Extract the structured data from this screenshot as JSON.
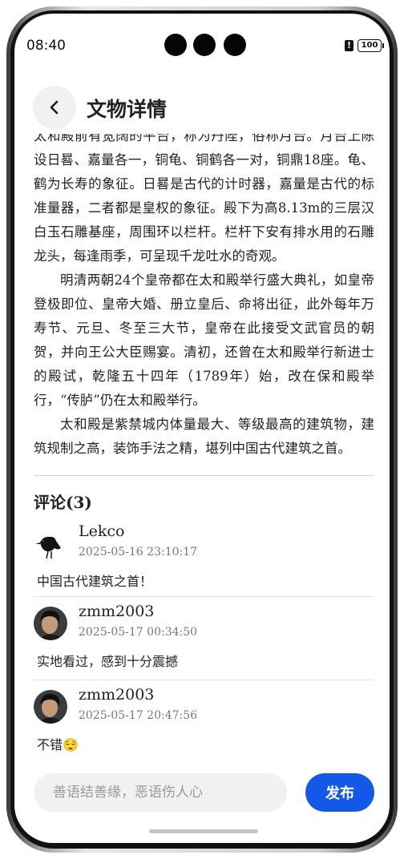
{
  "status_bar": {
    "time": "08:40",
    "battery": "100"
  },
  "header": {
    "title": "文物详情"
  },
  "article": {
    "paragraphs": [
      "太和殿前有宽阔的平台，称为丹陛，俗称月台。月台上陈设日晷、嘉量各一，铜龟、铜鹤各一对，铜鼎18座。龟、鹤为长寿的象征。日晷是古代的计时器，嘉量是古代的标准量器，二者都是皇权的象征。殿下为高8.13m的三层汉白玉石雕基座，周围环以栏杆。栏杆下安有排水用的石雕龙头，每逢雨季，可呈现千龙吐水的奇观。",
      "明清两朝24个皇帝都在太和殿举行盛大典礼，如皇帝登极即位、皇帝大婚、册立皇后、命将出征，此外每年万寿节、元旦、冬至三大节，皇帝在此接受文武官员的朝贺，并向王公大臣赐宴。清初，还曾在太和殿举行新进士的殿试，乾隆五十四年（1789年）始，改在保和殿举行，“传胪”仍在太和殿举行。",
      "太和殿是紫禁城内体量最大、等级最高的建筑物，建筑规制之高，装饰手法之精，堪列中国古代建筑之首。"
    ]
  },
  "comments": {
    "title": "评论(3)",
    "items": [
      {
        "user": "Lekco",
        "time": "2025-05-16 23:10:17",
        "text": "中国古代建筑之首！",
        "avatar": "crow-avatar"
      },
      {
        "user": "zmm2003",
        "time": "2025-05-17 00:34:50",
        "text": "实地看过，感到十分震撼",
        "avatar": "person-avatar"
      },
      {
        "user": "zmm2003",
        "time": "2025-05-17 20:47:56",
        "text": "不错😌",
        "avatar": "person-avatar"
      }
    ]
  },
  "input": {
    "placeholder": "善语结善缘，恶语伤人心",
    "value": ""
  },
  "publish_label": "发布"
}
